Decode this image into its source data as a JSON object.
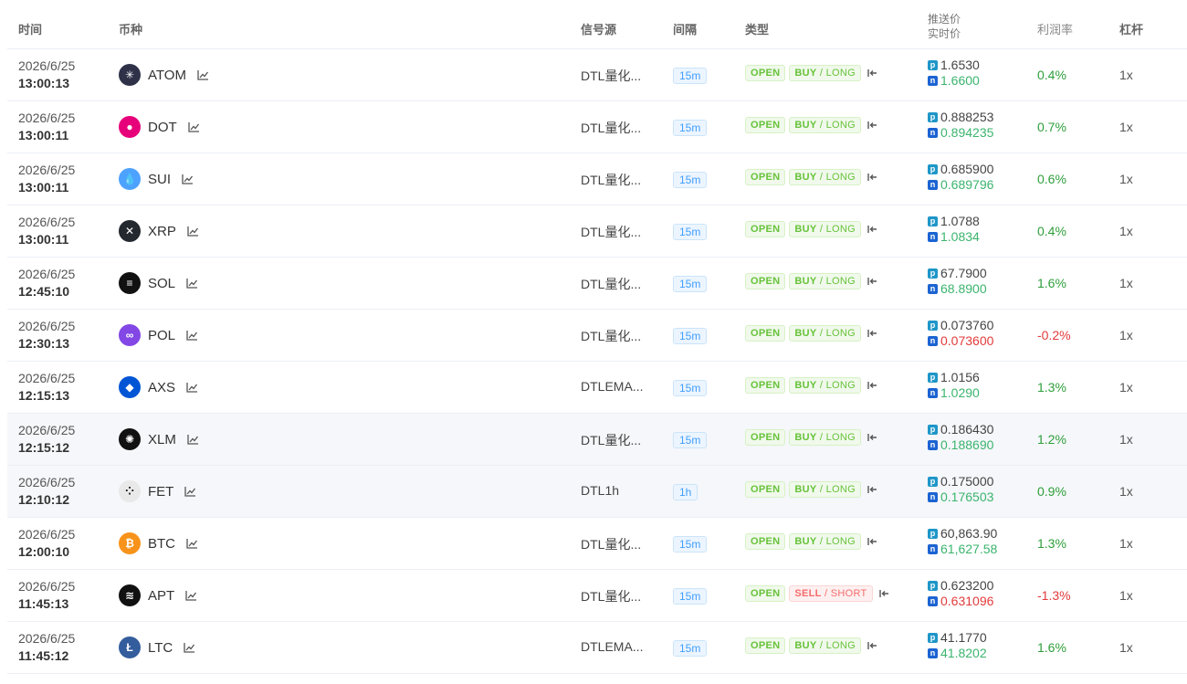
{
  "columns": {
    "time": "时间",
    "coin": "币种",
    "source": "信号源",
    "interval": "间隔",
    "type": "类型",
    "push_price": "推送价",
    "realtime_price": "实时价",
    "profit": "利润率",
    "leverage": "杠杆"
  },
  "type_labels": {
    "open": "OPEN",
    "buy": "BUY",
    "long": " / LONG",
    "sell": "SELL",
    "short": " / SHORT"
  },
  "price_badges": {
    "push": "p",
    "realtime": "n"
  },
  "rows": [
    {
      "date": "2026/6/25",
      "clock": "13:00:13",
      "coin": "ATOM",
      "icon": "atom-icon",
      "icon_color": "#2e3148",
      "icon_glyph": "✳",
      "source": "DTL量化...",
      "interval": "15m",
      "direction": "buy",
      "push": "1.6530",
      "realtime": "1.6600",
      "realtime_trend": "up",
      "profit": "0.4%",
      "profit_trend": "up",
      "leverage": "1x"
    },
    {
      "date": "2026/6/25",
      "clock": "13:00:11",
      "coin": "DOT",
      "icon": "polkadot-icon",
      "icon_color": "#e6007a",
      "icon_glyph": "●",
      "source": "DTL量化...",
      "interval": "15m",
      "direction": "buy",
      "push": "0.888253",
      "realtime": "0.894235",
      "realtime_trend": "up",
      "profit": "0.7%",
      "profit_trend": "up",
      "leverage": "1x"
    },
    {
      "date": "2026/6/25",
      "clock": "13:00:11",
      "coin": "SUI",
      "icon": "sui-icon",
      "icon_color": "#4da2ff",
      "icon_glyph": "💧",
      "source": "DTL量化...",
      "interval": "15m",
      "direction": "buy",
      "push": "0.685900",
      "realtime": "0.689796",
      "realtime_trend": "up",
      "profit": "0.6%",
      "profit_trend": "up",
      "leverage": "1x"
    },
    {
      "date": "2026/6/25",
      "clock": "13:00:11",
      "coin": "XRP",
      "icon": "xrp-icon",
      "icon_color": "#23292f",
      "icon_glyph": "✕",
      "source": "DTL量化...",
      "interval": "15m",
      "direction": "buy",
      "push": "1.0788",
      "realtime": "1.0834",
      "realtime_trend": "up",
      "profit": "0.4%",
      "profit_trend": "up",
      "leverage": "1x"
    },
    {
      "date": "2026/6/25",
      "clock": "12:45:10",
      "coin": "SOL",
      "icon": "solana-icon",
      "icon_color": "#111111",
      "icon_glyph": "≡",
      "source": "DTL量化...",
      "interval": "15m",
      "direction": "buy",
      "push": "67.7900",
      "realtime": "68.8900",
      "realtime_trend": "up",
      "profit": "1.6%",
      "profit_trend": "up",
      "leverage": "1x"
    },
    {
      "date": "2026/6/25",
      "clock": "12:30:13",
      "coin": "POL",
      "icon": "polygon-icon",
      "icon_color": "#8247e5",
      "icon_glyph": "∞",
      "source": "DTL量化...",
      "interval": "15m",
      "direction": "buy",
      "push": "0.073760",
      "realtime": "0.073600",
      "realtime_trend": "down",
      "profit": "-0.2%",
      "profit_trend": "down",
      "leverage": "1x"
    },
    {
      "date": "2026/6/25",
      "clock": "12:15:13",
      "coin": "AXS",
      "icon": "axie-icon",
      "icon_color": "#0055d5",
      "icon_glyph": "◆",
      "source": "DTLEMA...",
      "interval": "15m",
      "direction": "buy",
      "push": "1.0156",
      "realtime": "1.0290",
      "realtime_trend": "up",
      "profit": "1.3%",
      "profit_trend": "up",
      "leverage": "1x"
    },
    {
      "date": "2026/6/25",
      "clock": "12:15:12",
      "coin": "XLM",
      "icon": "stellar-icon",
      "icon_color": "#111111",
      "icon_glyph": "✺",
      "source": "DTL量化...",
      "interval": "15m",
      "direction": "buy",
      "push": "0.186430",
      "realtime": "0.188690",
      "realtime_trend": "up",
      "profit": "1.2%",
      "profit_trend": "up",
      "leverage": "1x",
      "highlight": true
    },
    {
      "date": "2026/6/25",
      "clock": "12:10:12",
      "coin": "FET",
      "icon": "fetch-icon",
      "icon_color": "#e9e9e9",
      "icon_glyph": "⁘",
      "source": "DTL1h",
      "interval": "1h",
      "direction": "buy",
      "push": "0.175000",
      "realtime": "0.176503",
      "realtime_trend": "up",
      "profit": "0.9%",
      "profit_trend": "up",
      "leverage": "1x",
      "highlight": true
    },
    {
      "date": "2026/6/25",
      "clock": "12:00:10",
      "coin": "BTC",
      "icon": "bitcoin-icon",
      "icon_color": "#f7931a",
      "icon_glyph": "₿",
      "source": "DTL量化...",
      "interval": "15m",
      "direction": "buy",
      "push": "60,863.90",
      "realtime": "61,627.58",
      "realtime_trend": "up",
      "profit": "1.3%",
      "profit_trend": "up",
      "leverage": "1x"
    },
    {
      "date": "2026/6/25",
      "clock": "11:45:13",
      "coin": "APT",
      "icon": "aptos-icon",
      "icon_color": "#111111",
      "icon_glyph": "≋",
      "source": "DTL量化...",
      "interval": "15m",
      "direction": "sell",
      "push": "0.623200",
      "realtime": "0.631096",
      "realtime_trend": "down",
      "profit": "-1.3%",
      "profit_trend": "down",
      "leverage": "1x"
    },
    {
      "date": "2026/6/25",
      "clock": "11:45:12",
      "coin": "LTC",
      "icon": "litecoin-icon",
      "icon_color": "#345d9d",
      "icon_glyph": "Ł",
      "source": "DTLEMA...",
      "interval": "15m",
      "direction": "buy",
      "push": "41.1770",
      "realtime": "41.8202",
      "realtime_trend": "up",
      "profit": "1.6%",
      "profit_trend": "up",
      "leverage": "1x"
    }
  ]
}
